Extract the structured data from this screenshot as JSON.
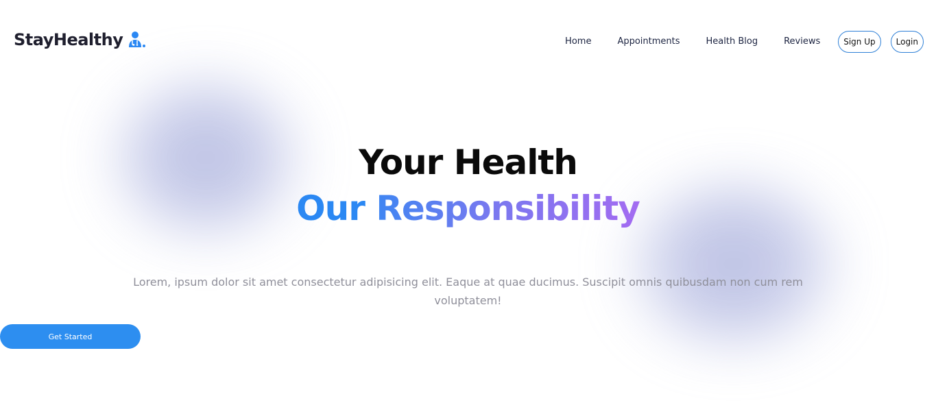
{
  "brand": {
    "name": "StayHealthy",
    "icon": "doctor-stethoscope-icon",
    "color": "#2b88f3"
  },
  "nav": {
    "links": [
      {
        "label": "Home"
      },
      {
        "label": "Appointments"
      },
      {
        "label": "Health Blog"
      },
      {
        "label": "Reviews"
      }
    ],
    "signup_label": "Sign Up",
    "login_label": "Login",
    "button_border_color": "#2d7fd6"
  },
  "hero": {
    "title": "Your Health",
    "subtitle_part1": "Our",
    "subtitle_part2": "Responsibility",
    "description": "Lorem, ipsum dolor sit amet consectetur adipisicing elit. Eaque at quae ducimus. Suscipit omnis quibusdam non cum rem voluptatem!",
    "cta_label": "Get Started",
    "accent_color": "#2b88f3",
    "gradient_end_color": "#a36bf1"
  }
}
